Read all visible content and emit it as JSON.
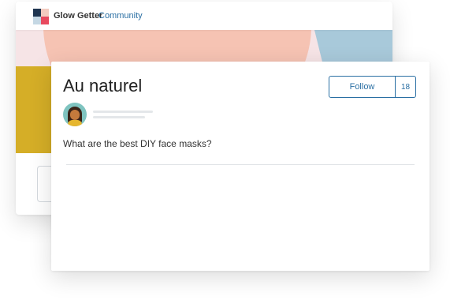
{
  "app": {
    "brand_name": "Glow Getter",
    "brand_sub": "Community"
  },
  "post": {
    "title": "Au naturel",
    "follow_label": "Follow",
    "follow_count": "18",
    "question": "What are the best DIY face masks?"
  },
  "colors": {
    "accent": "#2a6fa3",
    "hero_pink": "#f6c3b3",
    "hero_blue": "#a8c9da",
    "hero_yellow": "#d5ae27"
  },
  "icons": {
    "logo": "glow-getter-logo-icon",
    "avatar": "user-avatar"
  }
}
